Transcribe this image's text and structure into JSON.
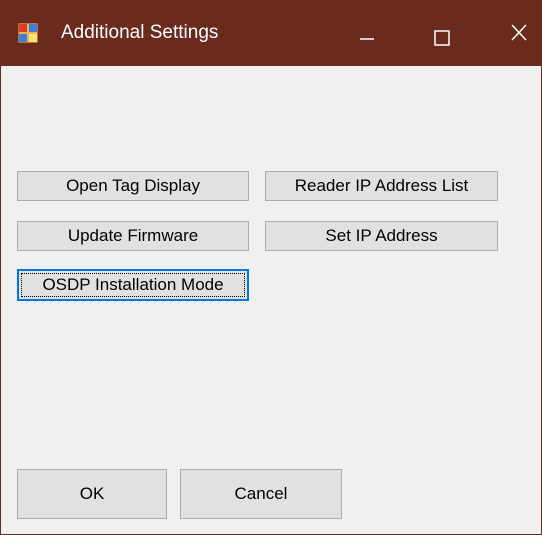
{
  "window": {
    "title": "Additional Settings",
    "icons": {
      "app": "app-icon",
      "minimize": "minimize-icon",
      "maximize": "maximize-icon",
      "close": "close-icon"
    },
    "colors": {
      "titlebar": "#6b2a1e",
      "background": "#f0f0f0",
      "button_face": "#e1e1e1",
      "button_border": "#adadad",
      "focus_border": "#0078d7"
    }
  },
  "buttons": {
    "open_tag_display": "Open Tag Display",
    "reader_ip_address_list": "Reader IP Address List",
    "update_firmware": "Update Firmware",
    "set_ip_address": "Set IP Address",
    "osdp_installation_mode": "OSDP Installation Mode",
    "ok": "OK",
    "cancel": "Cancel"
  },
  "focused_button": "osdp_installation_mode"
}
